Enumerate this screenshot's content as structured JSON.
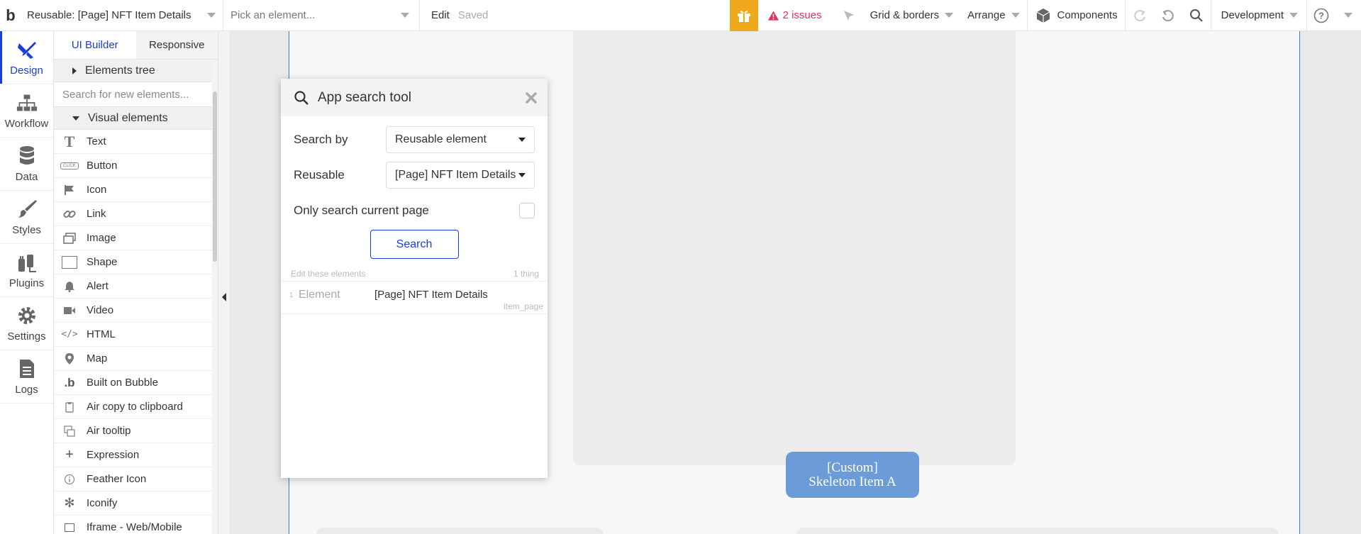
{
  "topbar": {
    "logo": "b",
    "page_selector": "Reusable: [Page] NFT Item Details",
    "element_picker_placeholder": "Pick an element...",
    "edit_label": "Edit",
    "saved_label": "Saved",
    "issues_label": "2 issues",
    "grid_label": "Grid & borders",
    "arrange_label": "Arrange",
    "components_label": "Components",
    "branch_label": "Development",
    "gift_color": "#f0a81c",
    "issues_color": "#e3315a"
  },
  "rail": {
    "items": [
      {
        "label": "Design",
        "icon": "design-icon",
        "active": true
      },
      {
        "label": "Workflow",
        "icon": "workflow-icon"
      },
      {
        "label": "Data",
        "icon": "database-icon"
      },
      {
        "label": "Styles",
        "icon": "brush-icon"
      },
      {
        "label": "Plugins",
        "icon": "plug-icon"
      },
      {
        "label": "Settings",
        "icon": "gear-icon"
      },
      {
        "label": "Logs",
        "icon": "document-icon"
      }
    ]
  },
  "panel": {
    "tabs": [
      "UI Builder",
      "Responsive"
    ],
    "elements_tree_label": "Elements tree",
    "search_placeholder": "Search for new elements...",
    "visual_elements_label": "Visual elements",
    "elements": [
      {
        "label": "Text",
        "icon": "text-icon"
      },
      {
        "label": "Button",
        "icon": "button-icon"
      },
      {
        "label": "Icon",
        "icon": "flag-icon"
      },
      {
        "label": "Link",
        "icon": "link-icon"
      },
      {
        "label": "Image",
        "icon": "image-icon"
      },
      {
        "label": "Shape",
        "icon": "shape-icon"
      },
      {
        "label": "Alert",
        "icon": "bell-icon"
      },
      {
        "label": "Video",
        "icon": "video-icon"
      },
      {
        "label": "HTML",
        "icon": "code-icon"
      },
      {
        "label": "Map",
        "icon": "map-pin-icon"
      },
      {
        "label": "Built on Bubble",
        "icon": "bubble-logo-icon"
      },
      {
        "label": "Air copy to clipboard",
        "icon": "clipboard-icon"
      },
      {
        "label": "Air tooltip",
        "icon": "tooltip-icon"
      },
      {
        "label": "Expression",
        "icon": "plus-icon"
      },
      {
        "label": "Feather Icon",
        "icon": "info-icon"
      },
      {
        "label": "Iconify",
        "icon": "asterisk-icon"
      },
      {
        "label": "Iframe - Web/Mobile",
        "icon": "frame-icon"
      }
    ],
    "button_glyph": "CLICK"
  },
  "search_tool": {
    "title": "App search tool",
    "search_by_label": "Search by",
    "search_by_value": "Reusable element",
    "reusable_label": "Reusable",
    "reusable_value": "[Page] NFT Item Details",
    "only_current_label": "Only search current page",
    "search_button": "Search",
    "edit_label": "Edit these elements",
    "count_label": "1 thing",
    "results": [
      {
        "index": "1",
        "type": "Element",
        "name": "[Page] NFT Item Details",
        "id": "item_page"
      }
    ]
  },
  "canvas": {
    "custom_label_line1": "[Custom]",
    "custom_label_line2": "Skeleton Item A",
    "custom_color": "#6c9cd8"
  }
}
